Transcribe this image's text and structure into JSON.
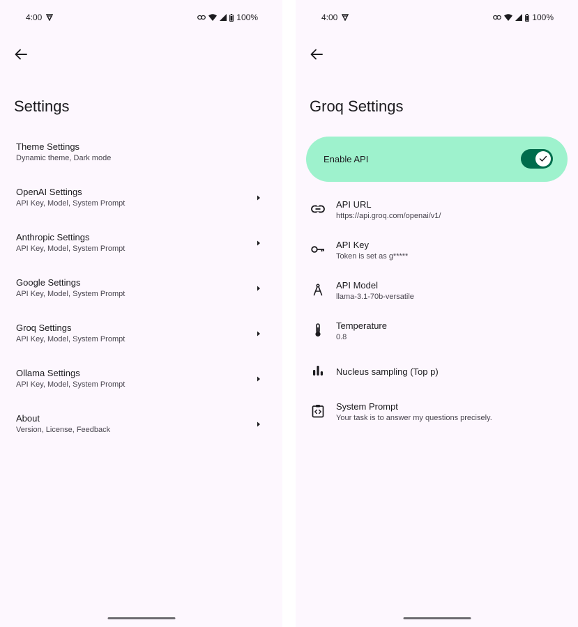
{
  "status": {
    "time": "4:00",
    "battery": "100%"
  },
  "left": {
    "title": "Settings",
    "items": [
      {
        "title": "Theme Settings",
        "subtitle": "Dynamic theme, Dark mode"
      },
      {
        "title": "OpenAI Settings",
        "subtitle": "API Key, Model, System Prompt"
      },
      {
        "title": "Anthropic Settings",
        "subtitle": "API Key, Model, System Prompt"
      },
      {
        "title": "Google Settings",
        "subtitle": "API Key, Model, System Prompt"
      },
      {
        "title": "Groq Settings",
        "subtitle": "API Key, Model, System Prompt"
      },
      {
        "title": "Ollama Settings",
        "subtitle": "API Key, Model, System Prompt"
      },
      {
        "title": "About",
        "subtitle": "Version, License, Feedback"
      }
    ]
  },
  "right": {
    "title": "Groq Settings",
    "enable_api": {
      "label": "Enable API",
      "enabled": true
    },
    "items": [
      {
        "title": "API URL",
        "subtitle": "https://api.groq.com/openai/v1/",
        "icon": "link-icon"
      },
      {
        "title": "API Key",
        "subtitle": "Token is set as g*****",
        "icon": "key-icon"
      },
      {
        "title": "API Model",
        "subtitle": "llama-3.1-70b-versatile",
        "icon": "compass-icon"
      },
      {
        "title": "Temperature",
        "subtitle": "0.8",
        "icon": "thermometer-icon"
      },
      {
        "title": "Nucleus sampling (Top p)",
        "subtitle": "",
        "icon": "bar-chart-icon"
      },
      {
        "title": "System Prompt",
        "subtitle": "Your task is to answer my questions precisely.",
        "icon": "code-clipboard-icon"
      }
    ]
  },
  "colors": {
    "background": "#fdf7fe",
    "accent_card": "#9ef2cd",
    "toggle": "#006c4c"
  }
}
